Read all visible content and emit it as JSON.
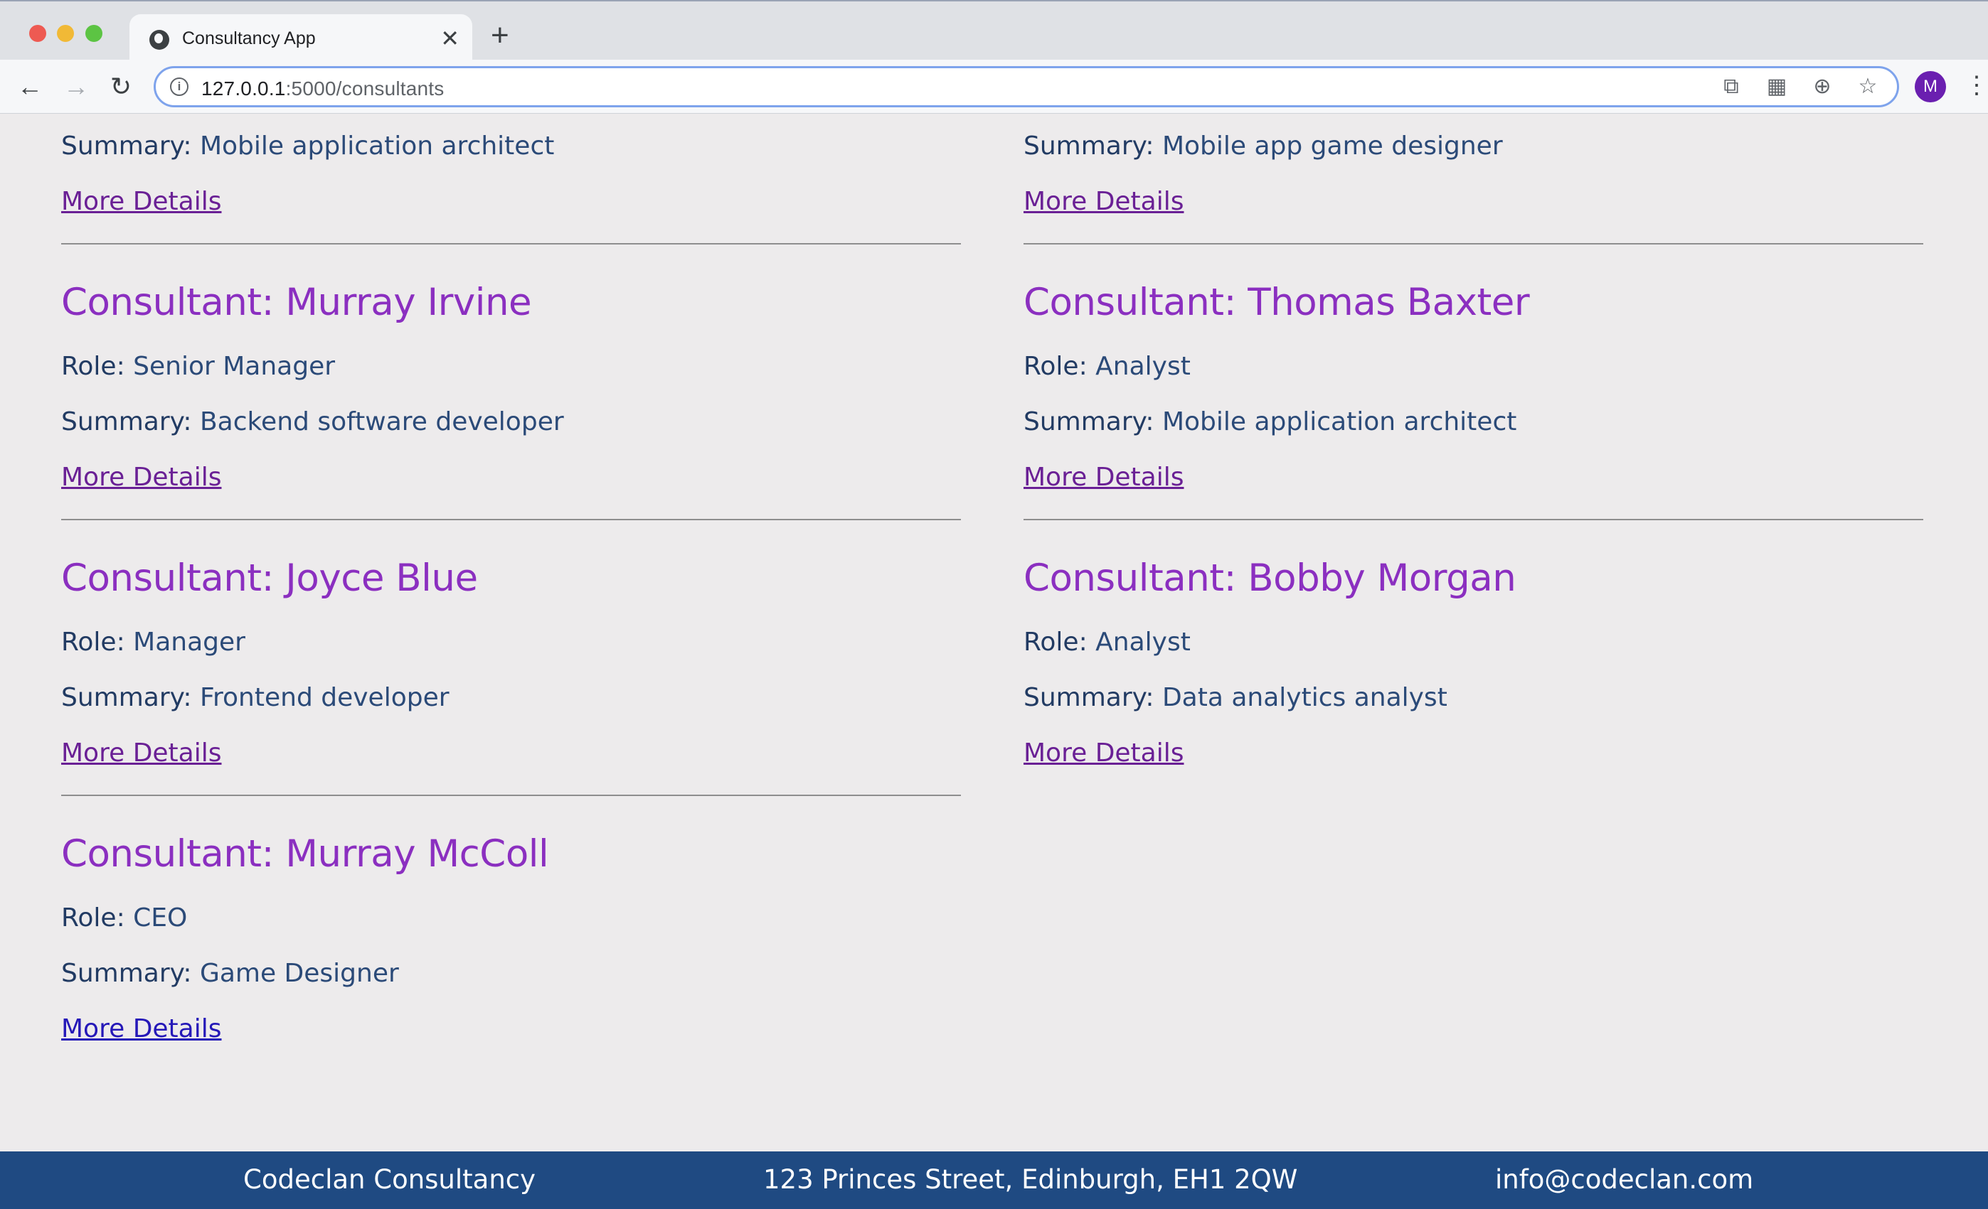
{
  "browser": {
    "tab_title": "Consultancy App",
    "url_host": "127.0.0.1",
    "url_path": ":5000/consultants",
    "profile_initial": "M"
  },
  "partial_top": {
    "left_summary_label": "Summary:",
    "left_summary": "Mobile application architect",
    "left_link": "More Details",
    "right_summary_label": "Summary:",
    "right_summary": "Mobile app game designer",
    "right_link": "More Details"
  },
  "consultants_left": [
    {
      "title": "Consultant: Murray Irvine",
      "role_label": "Role:",
      "role": "Senior Manager",
      "summary_label": "Summary:",
      "summary": "Backend software developer",
      "link": "More Details"
    },
    {
      "title": "Consultant: Joyce Blue",
      "role_label": "Role:",
      "role": "Manager",
      "summary_label": "Summary:",
      "summary": "Frontend developer",
      "link": "More Details"
    },
    {
      "title": "Consultant: Murray McColl",
      "role_label": "Role:",
      "role": "CEO",
      "summary_label": "Summary:",
      "summary": "Game Designer",
      "link": "More Details"
    }
  ],
  "consultants_right": [
    {
      "title": "Consultant: Thomas Baxter",
      "role_label": "Role:",
      "role": "Analyst",
      "summary_label": "Summary:",
      "summary": "Mobile application architect",
      "link": "More Details"
    },
    {
      "title": "Consultant: Bobby Morgan",
      "role_label": "Role:",
      "role": "Analyst",
      "summary_label": "Summary:",
      "summary": "Data analytics analyst",
      "link": "More Details"
    }
  ],
  "footer": {
    "company": "Codeclan Consultancy",
    "address": "123 Princes Street, Edinburgh, EH1 2QW",
    "email": "info@codeclan.com"
  },
  "colors": {
    "title_purple": "#8b2fc0",
    "text_navy": "#243e6b",
    "footer_bg": "#1f4a82",
    "page_bg": "#edebec"
  }
}
